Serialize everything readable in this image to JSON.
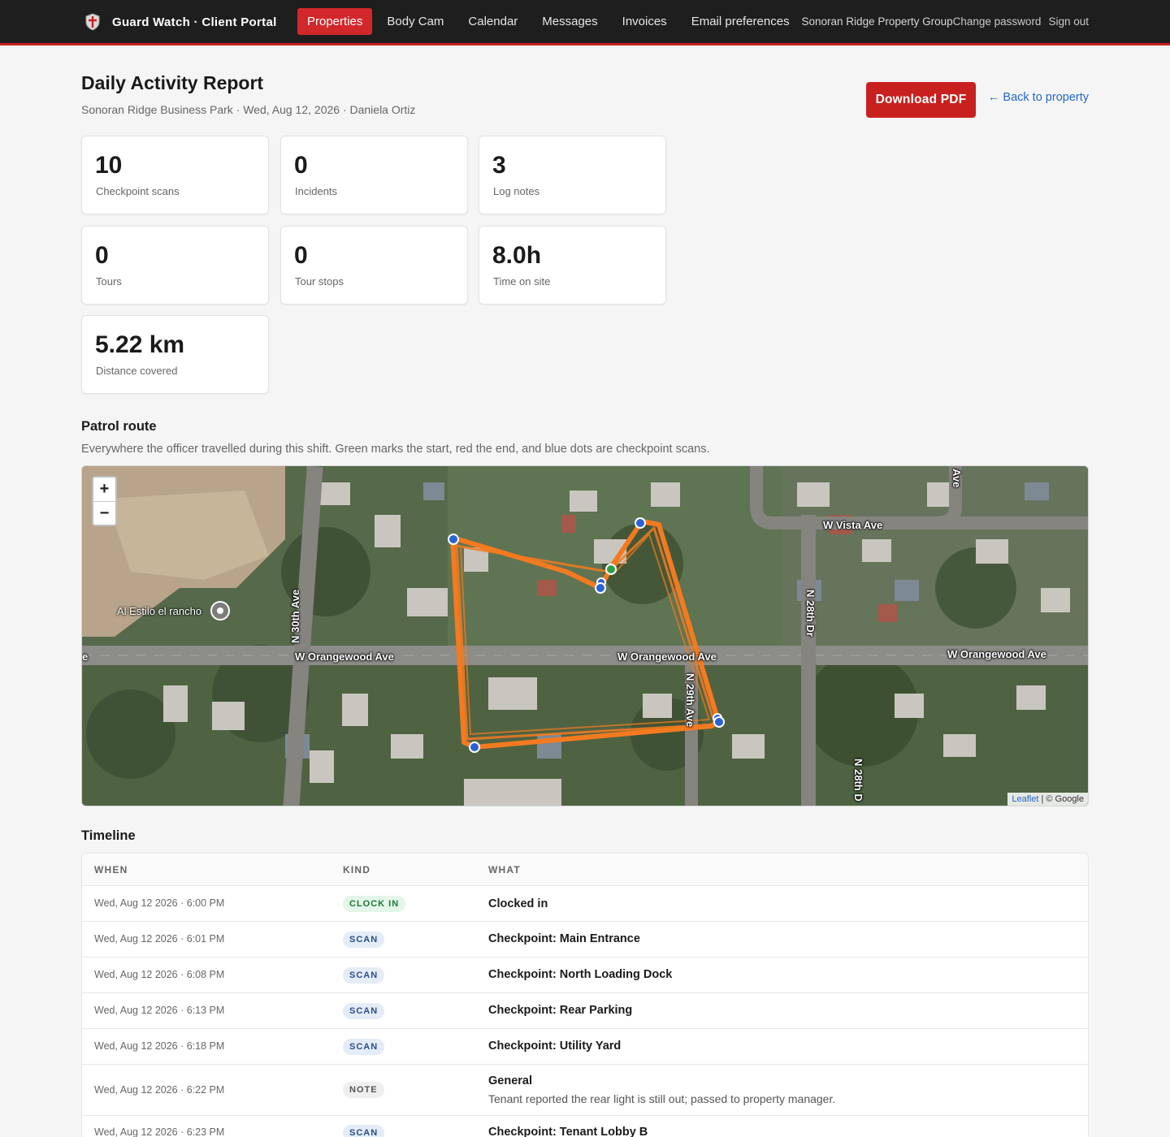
{
  "nav": {
    "brand": "Guard Watch · Client Portal",
    "items": [
      {
        "label": "Properties",
        "active": true
      },
      {
        "label": "Body Cam"
      },
      {
        "label": "Calendar"
      },
      {
        "label": "Messages"
      },
      {
        "label": "Invoices"
      },
      {
        "label": "Email preferences"
      }
    ],
    "org": "Sonoran Ridge Property Group",
    "change_password": "Change password",
    "sign_out": "Sign out"
  },
  "header": {
    "title": "Daily Activity Report",
    "subtitle": "Sonoran Ridge Business Park · Wed, Aug 12, 2026 · Daniela Ortiz",
    "download_label": "Download PDF",
    "back_label": "← Back to property"
  },
  "stats": [
    {
      "value": "10",
      "label": "Checkpoint scans"
    },
    {
      "value": "0",
      "label": "Incidents"
    },
    {
      "value": "3",
      "label": "Log notes"
    },
    {
      "value": "0",
      "label": "Tours"
    },
    {
      "value": "0",
      "label": "Tour stops"
    },
    {
      "value": "8.0h",
      "label": "Time on site"
    },
    {
      "value": "5.22 km",
      "label": "Distance covered"
    }
  ],
  "patrol": {
    "title": "Patrol route",
    "description": "Everywhere the officer travelled during this shift. Green marks the start, red the end, and blue dots are checkpoint scans.",
    "zoom_in": "+",
    "zoom_out": "−",
    "attribution_leaflet": "Leaflet",
    "attribution_sep": " | © Google",
    "poi": "Al Estilo el rancho",
    "streets": {
      "w_orangewood_1": "W Orangewood Ave",
      "w_orangewood_2": "W Orangewood Ave",
      "w_orangewood_3": "W Orangewood Ave",
      "w_vista": "W Vista Ave",
      "n_30th": "N 30th Ave",
      "n_29th": "N 29th Ave",
      "n_28th_dr": "N 28th Dr",
      "n_28th": "N 28th D",
      "ave_top": "Ave",
      "e_left": "e"
    },
    "colors": {
      "route": "#f47a20",
      "start": "#2ea043",
      "scan": "#2a62d6"
    }
  },
  "timeline": {
    "title": "Timeline",
    "columns": {
      "when": "WHEN",
      "kind": "KIND",
      "what": "WHAT"
    },
    "rows": [
      {
        "when": "Wed, Aug 12 2026 · 6:00 PM",
        "kind": "CLOCK IN",
        "what": "Clocked in",
        "detail": ""
      },
      {
        "when": "Wed, Aug 12 2026 · 6:01 PM",
        "kind": "SCAN",
        "what": "Checkpoint: Main Entrance",
        "detail": ""
      },
      {
        "when": "Wed, Aug 12 2026 · 6:08 PM",
        "kind": "SCAN",
        "what": "Checkpoint: North Loading Dock",
        "detail": ""
      },
      {
        "when": "Wed, Aug 12 2026 · 6:13 PM",
        "kind": "SCAN",
        "what": "Checkpoint: Rear Parking",
        "detail": ""
      },
      {
        "when": "Wed, Aug 12 2026 · 6:18 PM",
        "kind": "SCAN",
        "what": "Checkpoint: Utility Yard",
        "detail": ""
      },
      {
        "when": "Wed, Aug 12 2026 · 6:22 PM",
        "kind": "NOTE",
        "what": "General",
        "detail": "Tenant reported the rear light is still out; passed to property manager."
      },
      {
        "when": "Wed, Aug 12 2026 · 6:23 PM",
        "kind": "SCAN",
        "what": "Checkpoint: Tenant Lobby B",
        "detail": ""
      }
    ]
  }
}
